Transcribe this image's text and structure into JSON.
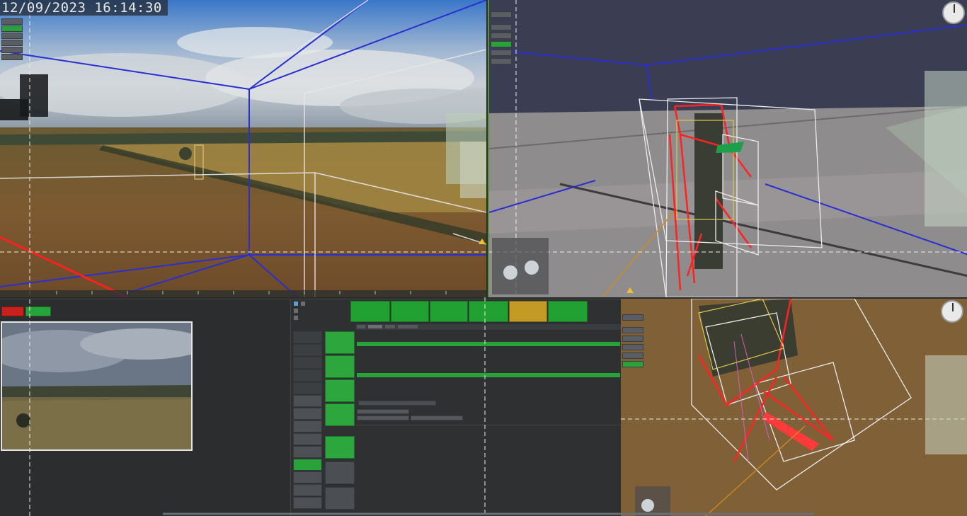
{
  "overlay": {
    "timestamp": "12/09/2023  16:14:30"
  },
  "left_camera_buttons": [
    "",
    "",
    "",
    "",
    "",
    ""
  ],
  "right_top_buttons": [
    "",
    "",
    "",
    "",
    "",
    ""
  ],
  "right_bottom_buttons": [
    "",
    "",
    "",
    "",
    "",
    ""
  ],
  "playback_panel": {
    "title": "",
    "stop_label": "",
    "play_label": "",
    "info_line": ""
  },
  "status_bar": [
    {
      "label": "",
      "detail": "",
      "color": "#22a133"
    },
    {
      "label": "",
      "detail": "",
      "color": "#22a133"
    },
    {
      "label": "",
      "detail": "",
      "color": "#22a133"
    },
    {
      "label": "",
      "detail": "",
      "color": "#22a133"
    },
    {
      "label": "",
      "detail": "",
      "color": "#c39a24"
    },
    {
      "label": "",
      "detail": "",
      "color": "#22a133"
    }
  ],
  "mission_list": {
    "header_left": "",
    "header_right": "",
    "items": [
      "",
      "",
      "",
      "",
      "",
      "",
      "",
      "",
      "",
      "",
      "",
      "",
      "",
      "",
      "",
      ""
    ],
    "active_index": 12,
    "dim_count": 4
  },
  "tools": {
    "items": [
      "",
      "",
      "",
      ""
    ],
    "section_label": "",
    "lower_items": [
      "",
      "",
      ""
    ]
  },
  "details_panel": {
    "tabs": [
      "",
      "",
      "",
      ""
    ],
    "title": "",
    "section1": "",
    "section2": "",
    "lines": [
      "",
      "",
      "",
      "",
      "",
      "",
      "",
      "",
      ""
    ],
    "button_top": "",
    "button_left": "",
    "button_right": "",
    "footer": ""
  },
  "colors": {
    "accent_green": "#27a33a",
    "warning_amber": "#c39a24",
    "panel_dark": "#2a2c2e",
    "wire_blue": "#2a2fd0",
    "wire_red": "#ff2a2a"
  }
}
